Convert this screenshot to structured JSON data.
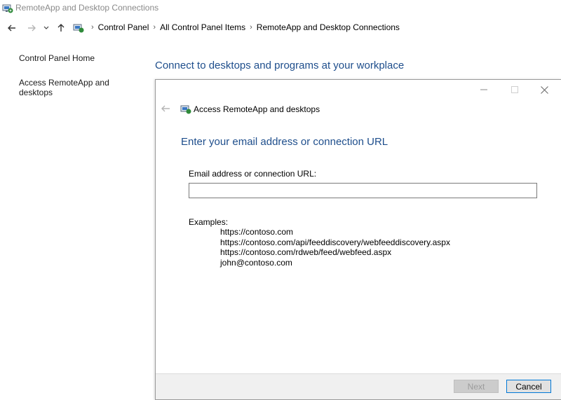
{
  "window": {
    "title": "RemoteApp and Desktop Connections"
  },
  "nav": {
    "breadcrumbs": [
      "Control Panel",
      "All Control Panel Items",
      "RemoteApp and Desktop Connections"
    ]
  },
  "left_pane": {
    "links": [
      "Control Panel Home",
      "Access RemoteApp and desktops"
    ]
  },
  "main": {
    "heading": "Connect to desktops and programs at your workplace"
  },
  "dialog": {
    "title": "Access RemoteApp and desktops",
    "heading": "Enter your email address or connection URL",
    "field_label": "Email address or connection URL:",
    "field_value": "",
    "examples_label": "Examples:",
    "examples": [
      "https://contoso.com",
      "https://contoso.com/api/feeddiscovery/webfeeddiscovery.aspx",
      "https://contoso.com/rdweb/feed/webfeed.aspx",
      "john@contoso.com"
    ],
    "next_label": "Next",
    "cancel_label": "Cancel"
  },
  "colors": {
    "heading_blue": "#1e4e8c",
    "accent": "#0078d7"
  },
  "icons": [
    "remoteapp-icon",
    "back-arrow-icon",
    "forward-arrow-icon",
    "chevron-down-icon",
    "up-arrow-icon",
    "minimize-icon",
    "maximize-icon",
    "close-icon"
  ]
}
